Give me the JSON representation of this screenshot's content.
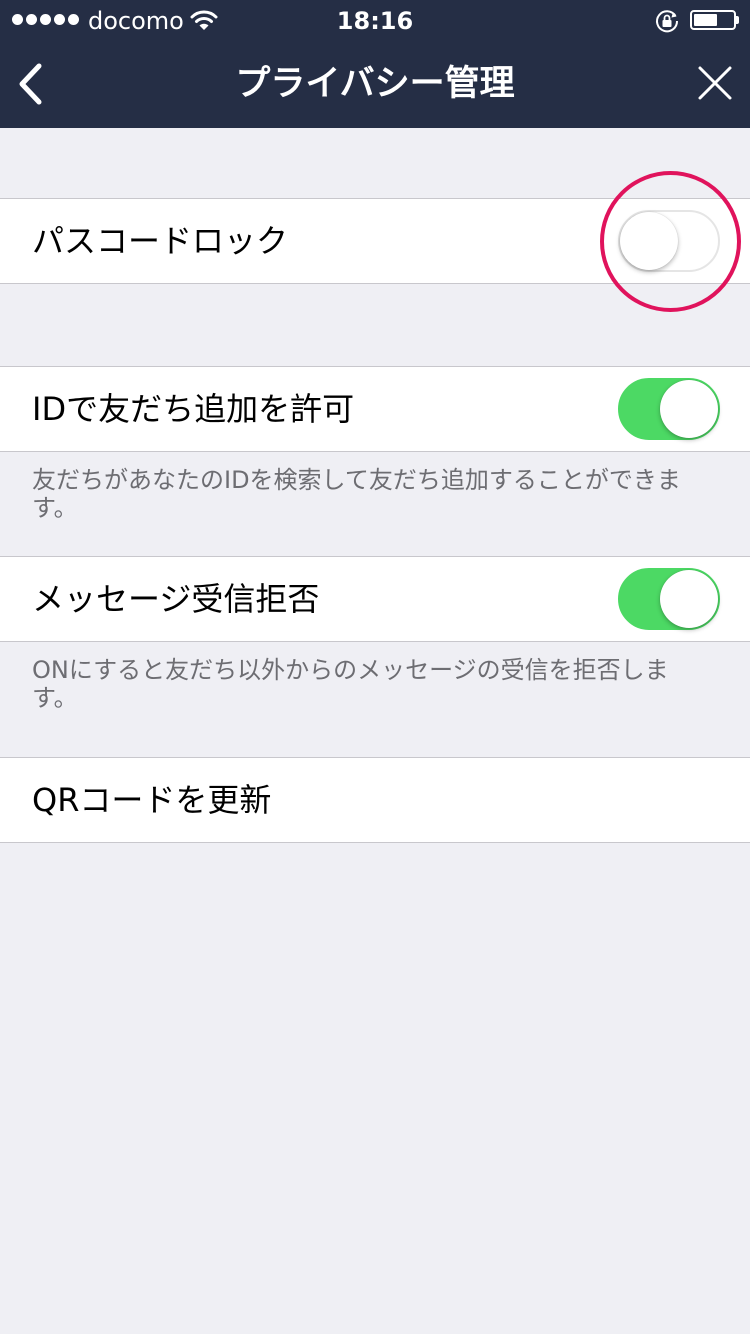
{
  "status_bar": {
    "carrier": "docomo",
    "time": "18:16",
    "signal_bars": 5,
    "battery_level": 0.6,
    "icons": [
      "signal-dots-icon",
      "wifi-icon",
      "rotation-lock-icon",
      "battery-icon"
    ]
  },
  "nav": {
    "title": "プライバシー管理",
    "back_icon": "chevron-left-icon",
    "close_icon": "close-icon"
  },
  "settings": {
    "passcode_lock": {
      "label": "パスコードロック",
      "enabled": false
    },
    "allow_id_add": {
      "label": "IDで友だち追加を許可",
      "enabled": true,
      "note": "友だちがあなたのIDを検索して友だち追加することができます。"
    },
    "reject_messages": {
      "label": "メッセージ受信拒否",
      "enabled": true,
      "note": "ONにすると友だち以外からのメッセージの受信を拒否します。"
    },
    "update_qr": {
      "label": "QRコードを更新"
    }
  },
  "colors": {
    "header_bg": "#252e45",
    "page_bg": "#efeff4",
    "toggle_on": "#4cd964",
    "highlight": "#e0135c",
    "note_text": "#6d6d72"
  }
}
